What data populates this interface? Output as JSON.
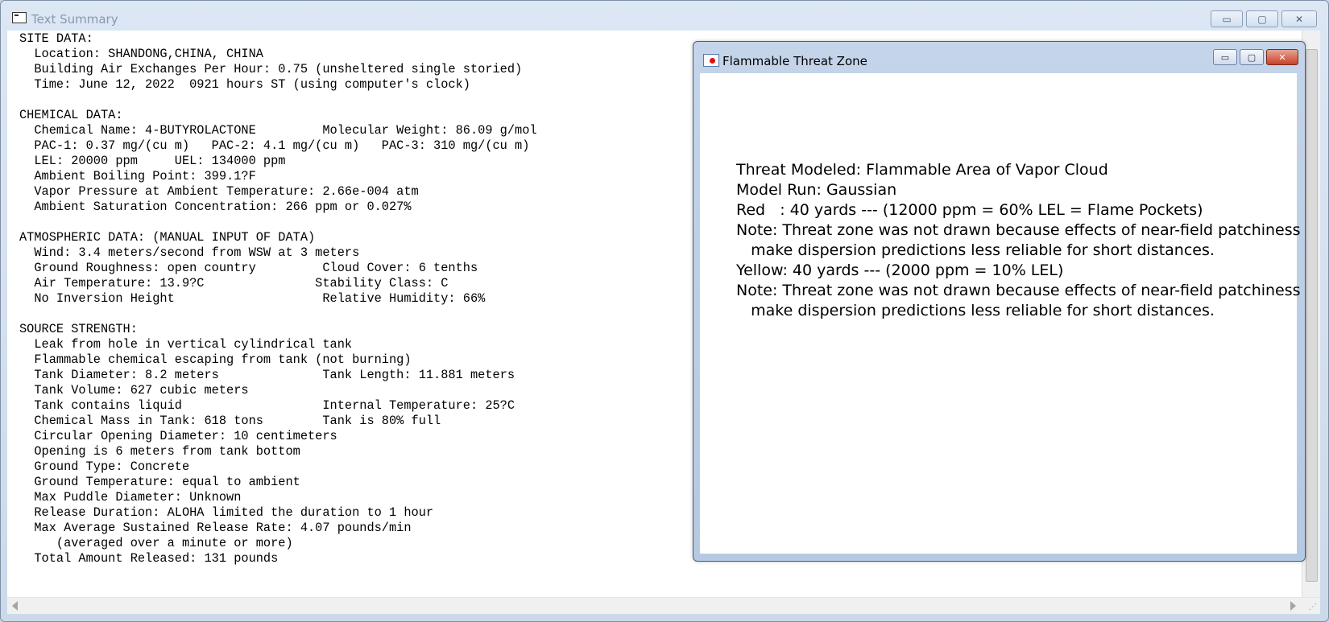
{
  "main_window": {
    "title": "Text Summary",
    "buttons": {
      "minimize": "▭",
      "maximize": "▢",
      "close": "✕"
    }
  },
  "summary_lines": [
    "SITE DATA:",
    "  Location: SHANDONG,CHINA, CHINA",
    "  Building Air Exchanges Per Hour: 0.75 (unsheltered single storied)",
    "  Time: June 12, 2022  0921 hours ST (using computer's clock)",
    "",
    "CHEMICAL DATA:",
    "  Chemical Name: 4-BUTYROLACTONE         Molecular Weight: 86.09 g/mol",
    "  PAC-1: 0.37 mg/(cu m)   PAC-2: 4.1 mg/(cu m)   PAC-3: 310 mg/(cu m)",
    "  LEL: 20000 ppm     UEL: 134000 ppm",
    "  Ambient Boiling Point: 399.1?F",
    "  Vapor Pressure at Ambient Temperature: 2.66e-004 atm",
    "  Ambient Saturation Concentration: 266 ppm or 0.027%",
    "",
    "ATMOSPHERIC DATA: (MANUAL INPUT OF DATA)",
    "  Wind: 3.4 meters/second from WSW at 3 meters",
    "  Ground Roughness: open country         Cloud Cover: 6 tenths",
    "  Air Temperature: 13.9?C               Stability Class: C",
    "  No Inversion Height                    Relative Humidity: 66%",
    "",
    "SOURCE STRENGTH:",
    "  Leak from hole in vertical cylindrical tank",
    "  Flammable chemical escaping from tank (not burning)",
    "  Tank Diameter: 8.2 meters              Tank Length: 11.881 meters",
    "  Tank Volume: 627 cubic meters",
    "  Tank contains liquid                   Internal Temperature: 25?C",
    "  Chemical Mass in Tank: 618 tons        Tank is 80% full",
    "  Circular Opening Diameter: 10 centimeters",
    "  Opening is 6 meters from tank bottom",
    "  Ground Type: Concrete",
    "  Ground Temperature: equal to ambient",
    "  Max Puddle Diameter: Unknown",
    "  Release Duration: ALOHA limited the duration to 1 hour",
    "  Max Average Sustained Release Rate: 4.07 pounds/min",
    "     (averaged over a minute or more)",
    "  Total Amount Released: 131 pounds"
  ],
  "threat_window": {
    "title": "Flammable Threat Zone",
    "lines": [
      "Threat Modeled: Flammable Area of Vapor Cloud",
      "Model Run: Gaussian",
      "Red   : 40 yards --- (12000 ppm = 60% LEL = Flame Pockets)",
      "Note: Threat zone was not drawn because effects of near-field patchiness",
      "   make dispersion predictions less reliable for short distances.",
      "Yellow: 40 yards --- (2000 ppm = 10% LEL)",
      "Note: Threat zone was not drawn because effects of near-field patchiness",
      "   make dispersion predictions less reliable for short distances."
    ]
  }
}
